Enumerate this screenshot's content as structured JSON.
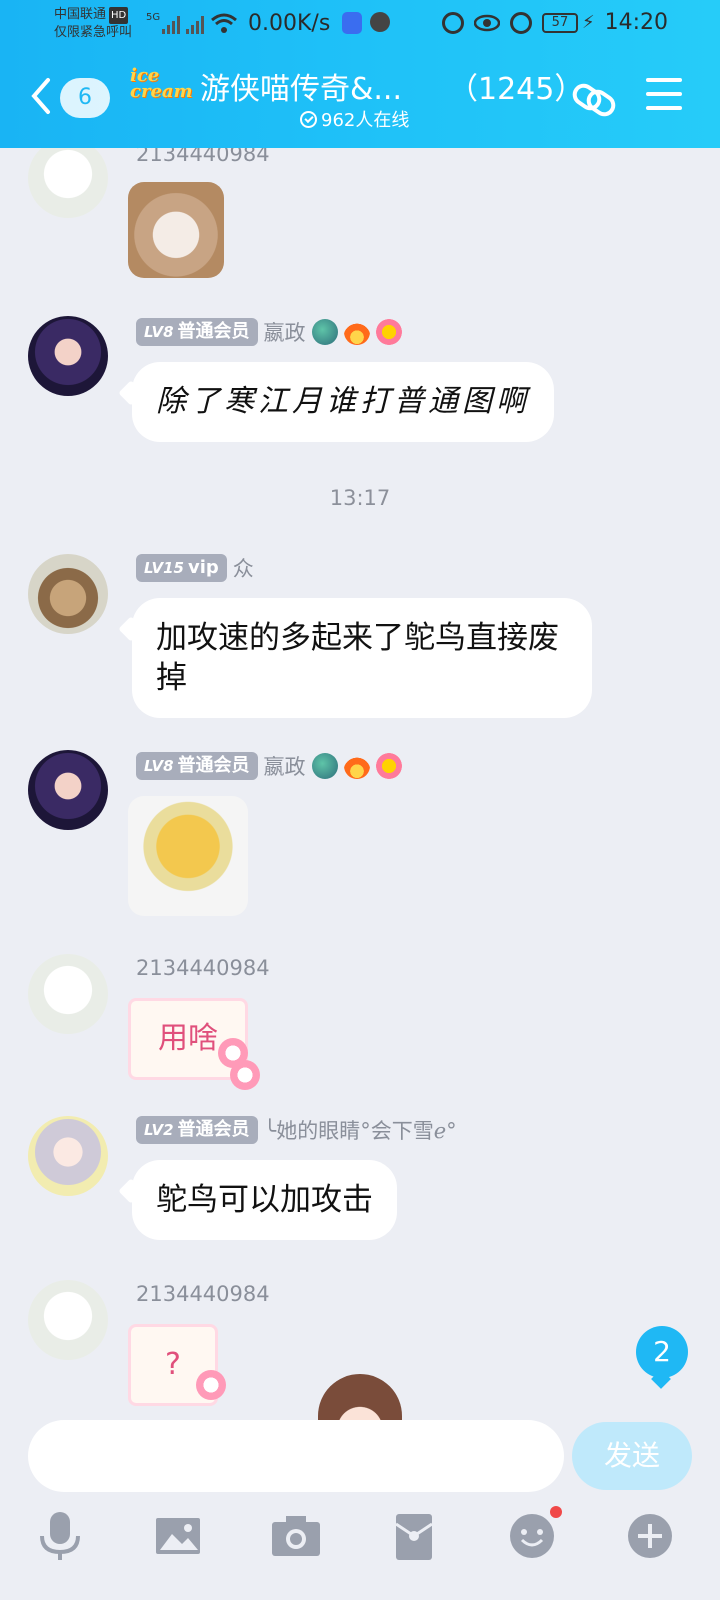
{
  "status_bar": {
    "carrier_line1": "中国联通",
    "carrier_hd": "HD",
    "carrier_line2": "仅限紧急呼叫",
    "network": "5G",
    "speed": "0.00K/s",
    "battery": "57",
    "time": "14:20"
  },
  "header": {
    "unread_count": "6",
    "logo_text": "ice cream",
    "group_name": "游侠喵传奇&...",
    "member_count": "（1245）",
    "online_text": "962人在线"
  },
  "messages": [
    {
      "sender": "2134440984",
      "type": "sticker",
      "sticker": "cat-face"
    },
    {
      "level": "LV8",
      "role": "普通会员",
      "sender": "嬴政",
      "type": "text",
      "text": "除了寒江月谁打普通图啊"
    },
    {
      "type": "time",
      "text": "13:17"
    },
    {
      "level": "LV15",
      "role": "vip",
      "sender": "众",
      "type": "text",
      "text": "加攻速的多起来了鸵鸟直接废掉"
    },
    {
      "level": "LV8",
      "role": "普通会员",
      "sender": "嬴政",
      "type": "sticker",
      "sticker": "yellow-duck"
    },
    {
      "sender": "2134440984",
      "type": "sticker",
      "sticker_text": "用啥"
    },
    {
      "level": "LV2",
      "role": "普通会员",
      "sender": "╰她的眼睛°会下雪ℯ°",
      "type": "text",
      "text": "鸵鸟可以加攻击"
    },
    {
      "sender": "2134440984",
      "type": "sticker",
      "sticker_text": "?"
    }
  ],
  "new_messages_badge": "2",
  "input": {
    "placeholder": "",
    "send_label": "发送"
  },
  "toolbar_icons": [
    "microphone-icon",
    "image-icon",
    "camera-icon",
    "red-packet-icon",
    "emoji-icon",
    "plus-icon"
  ],
  "colors": {
    "header_start": "#19b4f4",
    "header_end": "#26ccf9",
    "background": "#eceef4",
    "badge": "#a8adbb",
    "accent": "#1fb8f4"
  }
}
